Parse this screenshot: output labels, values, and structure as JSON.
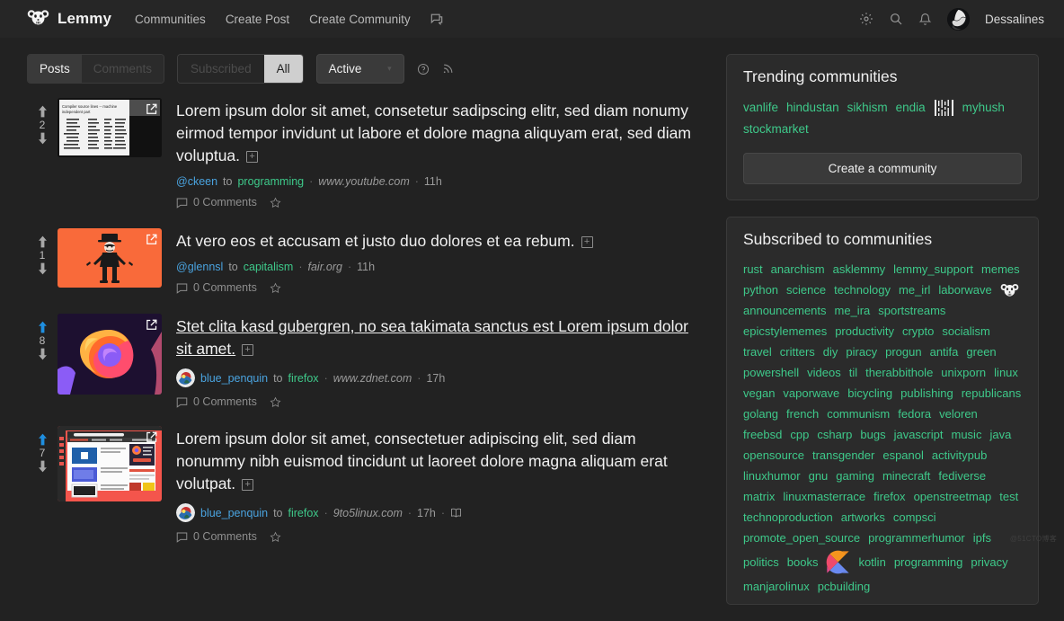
{
  "navbar": {
    "brand": "Lemmy",
    "brand_icon": "lemmy-mouse-icon",
    "links": [
      {
        "label": "Communities",
        "name": "communities"
      },
      {
        "label": "Create Post",
        "name": "create-post"
      },
      {
        "label": "Create Community",
        "name": "create-community"
      }
    ],
    "inbox_icon": "inbox-icon",
    "settings_icon": "gear-icon",
    "search_icon": "search-icon",
    "notifications_icon": "bell-icon",
    "user": "Dessalines",
    "avatar_icon": "user-avatar"
  },
  "filterbar": {
    "type_tabs": [
      {
        "label": "Posts",
        "active": true
      },
      {
        "label": "Comments",
        "active": false
      }
    ],
    "listing_tabs": [
      {
        "label": "Subscribed",
        "active": false
      },
      {
        "label": "All",
        "active": true
      }
    ],
    "sort": {
      "value": "Active",
      "caret": "▾"
    },
    "help_icon": "question-circle-icon",
    "rss_icon": "rss-icon"
  },
  "posts": [
    {
      "score": "2",
      "upvoted": false,
      "title": "Lorem ipsum dolor sit amet, consetetur sadipscing elitr, sed diam nonumy eirmod tempor invidunt ut labore et dolore magna aliquyam erat, sed diam voluptua.",
      "visited": false,
      "user": "@ckeen",
      "to": "to",
      "community": "programming",
      "domain": "www.youtube.com",
      "time": "11h",
      "comments": "0 Comments",
      "thumb": "compiler-source-lines-table",
      "has_avatar": false,
      "has_crosspost_icon": false,
      "expand_label": "+"
    },
    {
      "score": "1",
      "upvoted": false,
      "title": "At vero eos et accusam et justo duo dolores et ea rebum.",
      "visited": false,
      "user": "@glennsl",
      "to": "to",
      "community": "capitalism",
      "domain": "fair.org",
      "time": "11h",
      "comments": "0 Comments",
      "thumb": "capitalist-cartoon-orange",
      "has_avatar": false,
      "has_crosspost_icon": false,
      "expand_label": "+"
    },
    {
      "score": "8",
      "upvoted": true,
      "title": "Stet clita kasd gubergren, no sea takimata sanctus est Lorem ipsum dolor sit amet.",
      "visited": true,
      "user": "blue_penquin",
      "to": "to",
      "community": "firefox",
      "domain": "www.zdnet.com",
      "time": "17h",
      "comments": "0 Comments",
      "thumb": "firefox-logo",
      "has_avatar": true,
      "has_crosspost_icon": false,
      "expand_label": "+"
    },
    {
      "score": "7",
      "upvoted": true,
      "title": "Lorem ipsum dolor sit amet, consectetuer adipiscing elit, sed diam nonummy nibh euismod tincidunt ut laoreet dolore magna aliquam erat volutpat.",
      "visited": false,
      "user": "blue_penquin",
      "to": "to",
      "community": "firefox",
      "domain": "9to5linux.com",
      "time": "17h",
      "comments": "0 Comments",
      "thumb": "browser-screenshot-red",
      "has_avatar": true,
      "has_crosspost_icon": true,
      "expand_label": "+"
    }
  ],
  "trending": {
    "title": "Trending communities",
    "items": [
      {
        "label": "vanlife",
        "type": "link"
      },
      {
        "label": "hindustan",
        "type": "link"
      },
      {
        "label": "sikhism",
        "type": "link"
      },
      {
        "label": "endia",
        "type": "link"
      },
      {
        "label": "",
        "type": "icon",
        "icon": "myhush-barcode-icon"
      },
      {
        "label": "myhush",
        "type": "link"
      },
      {
        "label": "stockmarket",
        "type": "link"
      }
    ],
    "create_button": "Create a community"
  },
  "subscribed": {
    "title": "Subscribed to communities",
    "items": [
      {
        "label": "rust",
        "type": "link"
      },
      {
        "label": "anarchism",
        "type": "link"
      },
      {
        "label": "asklemmy",
        "type": "link"
      },
      {
        "label": "lemmy_support",
        "type": "link"
      },
      {
        "label": "memes",
        "type": "link"
      },
      {
        "label": "python",
        "type": "link"
      },
      {
        "label": "science",
        "type": "link"
      },
      {
        "label": "technology",
        "type": "link"
      },
      {
        "label": "me_irl",
        "type": "link"
      },
      {
        "label": "laborwave",
        "type": "link"
      },
      {
        "label": "",
        "type": "icon",
        "icon": "lemmy-mouse-icon"
      },
      {
        "label": "announcements",
        "type": "link"
      },
      {
        "label": "me_ira",
        "type": "link"
      },
      {
        "label": "sportstreams",
        "type": "link"
      },
      {
        "label": "epicstylememes",
        "type": "link"
      },
      {
        "label": "productivity",
        "type": "link"
      },
      {
        "label": "crypto",
        "type": "link"
      },
      {
        "label": "socialism",
        "type": "link"
      },
      {
        "label": "travel",
        "type": "link"
      },
      {
        "label": "critters",
        "type": "link"
      },
      {
        "label": "diy",
        "type": "link"
      },
      {
        "label": "piracy",
        "type": "link"
      },
      {
        "label": "progun",
        "type": "link"
      },
      {
        "label": "antifa",
        "type": "link"
      },
      {
        "label": "green",
        "type": "link"
      },
      {
        "label": "powershell",
        "type": "link"
      },
      {
        "label": "videos",
        "type": "link"
      },
      {
        "label": "til",
        "type": "link"
      },
      {
        "label": "therabbithole",
        "type": "link"
      },
      {
        "label": "unixporn",
        "type": "link"
      },
      {
        "label": "linux",
        "type": "link"
      },
      {
        "label": "vegan",
        "type": "link"
      },
      {
        "label": "vaporwave",
        "type": "link"
      },
      {
        "label": "bicycling",
        "type": "link"
      },
      {
        "label": "publishing",
        "type": "link"
      },
      {
        "label": "republicans",
        "type": "link"
      },
      {
        "label": "golang",
        "type": "link"
      },
      {
        "label": "french",
        "type": "link"
      },
      {
        "label": "communism",
        "type": "link"
      },
      {
        "label": "fedora",
        "type": "link"
      },
      {
        "label": "veloren",
        "type": "link"
      },
      {
        "label": "freebsd",
        "type": "link"
      },
      {
        "label": "cpp",
        "type": "link"
      },
      {
        "label": "csharp",
        "type": "link"
      },
      {
        "label": "bugs",
        "type": "link"
      },
      {
        "label": "javascript",
        "type": "link"
      },
      {
        "label": "music",
        "type": "link"
      },
      {
        "label": "java",
        "type": "link"
      },
      {
        "label": "opensource",
        "type": "link"
      },
      {
        "label": "transgender",
        "type": "link"
      },
      {
        "label": "espanol",
        "type": "link"
      },
      {
        "label": "activitypub",
        "type": "link"
      },
      {
        "label": "linuxhumor",
        "type": "link"
      },
      {
        "label": "gnu",
        "type": "link"
      },
      {
        "label": "gaming",
        "type": "link"
      },
      {
        "label": "minecraft",
        "type": "link"
      },
      {
        "label": "fediverse",
        "type": "link"
      },
      {
        "label": "matrix",
        "type": "link"
      },
      {
        "label": "linuxmasterrace",
        "type": "link"
      },
      {
        "label": "firefox",
        "type": "link"
      },
      {
        "label": "openstreetmap",
        "type": "link"
      },
      {
        "label": "test",
        "type": "link"
      },
      {
        "label": "technoproduction",
        "type": "link"
      },
      {
        "label": "artworks",
        "type": "link"
      },
      {
        "label": "compsci",
        "type": "link"
      },
      {
        "label": "promote_open_source",
        "type": "link"
      },
      {
        "label": "programmerhumor",
        "type": "link"
      },
      {
        "label": "ipfs",
        "type": "link"
      },
      {
        "label": "politics",
        "type": "link"
      },
      {
        "label": "books",
        "type": "link"
      },
      {
        "label": "",
        "type": "icon",
        "icon": "kotlin-logo-icon"
      },
      {
        "label": "kotlin",
        "type": "link"
      },
      {
        "label": "programming",
        "type": "link"
      },
      {
        "label": "privacy",
        "type": "link"
      },
      {
        "label": "manjarolinux",
        "type": "link"
      },
      {
        "label": "pcbuilding",
        "type": "link"
      }
    ]
  },
  "watermark": "@51CTO博客",
  "colors": {
    "page_bg": "#222222",
    "navbar_bg": "#262626",
    "card_bg": "#2b2b2b",
    "community_green": "#3ec98a",
    "user_blue": "#4aa3df",
    "upvote_active": "#1f8fe0",
    "text": "#f0f0f0",
    "muted": "#8e8e8e"
  }
}
